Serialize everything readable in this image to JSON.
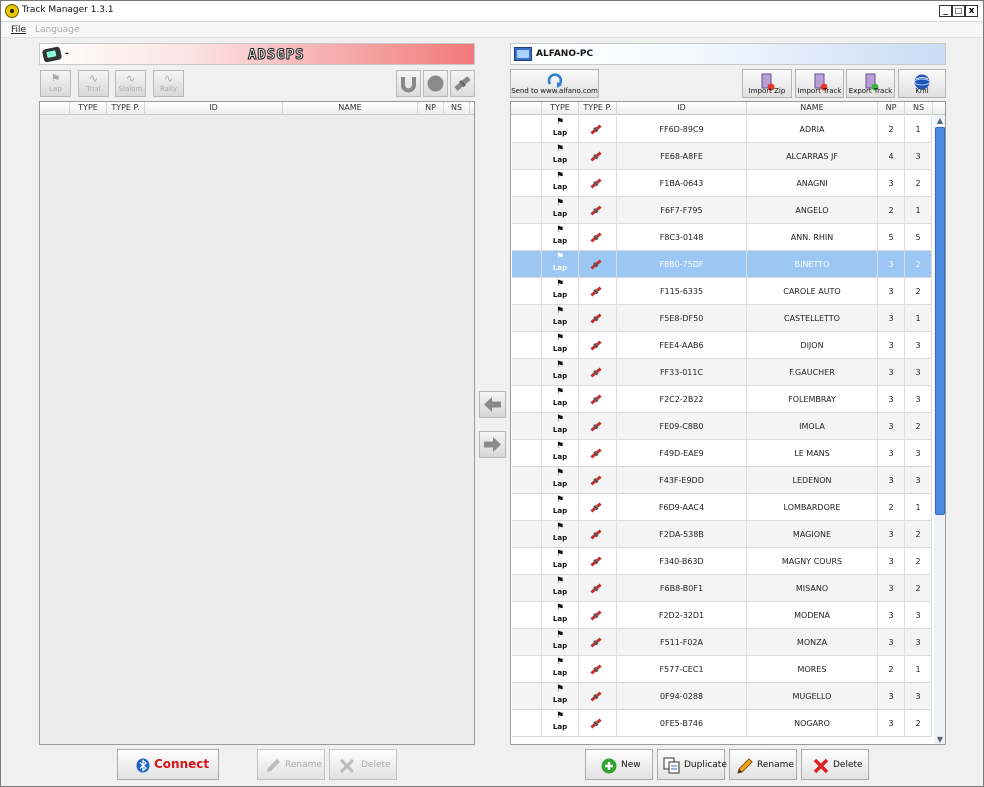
{
  "window": {
    "title": "Track Manager 1.3.1",
    "min": "_",
    "max": "□",
    "close": "x"
  },
  "menu": {
    "file": "File",
    "language": "Language"
  },
  "left_panel": {
    "device_label": "-",
    "logo": "ADSGPS",
    "toolbar": {
      "lap": "Lap",
      "trial": "Trial",
      "slalom": "Slalom",
      "rally": "Rally"
    },
    "columns": {
      "type": "TYPE",
      "type_p": "TYPE P.",
      "id": "ID",
      "name": "NAME",
      "np": "NP",
      "ns": "NS"
    },
    "buttons": {
      "connect": "Connect",
      "rename": "Rename",
      "delete": "Delete"
    }
  },
  "right_panel": {
    "pc_label": "ALFANO-PC",
    "toolbar": {
      "send": "Send to www.alfano.com",
      "import_zip": "Import Zip",
      "import_track": "Import Track",
      "export_track": "Export Track",
      "kml": "Kml"
    },
    "columns": {
      "type": "TYPE",
      "type_p": "TYPE P.",
      "id": "ID",
      "name": "NAME",
      "np": "NP",
      "ns": "NS"
    },
    "buttons": {
      "new": "New",
      "duplicate": "Duplicate",
      "rename": "Rename",
      "delete": "Delete"
    },
    "selected_row_index": 5,
    "tracks": [
      {
        "type": "Lap",
        "id": "FF6D-89C9",
        "name": "ADRIA",
        "np": "2",
        "ns": "1"
      },
      {
        "type": "Lap",
        "id": "FE68-A8FE",
        "name": "ALCARRAS JF",
        "np": "4",
        "ns": "3"
      },
      {
        "type": "Lap",
        "id": "F1BA-0643",
        "name": "ANAGNI",
        "np": "3",
        "ns": "2"
      },
      {
        "type": "Lap",
        "id": "F6F7-F795",
        "name": "ANGELO",
        "np": "2",
        "ns": "1"
      },
      {
        "type": "Lap",
        "id": "F8C3-0148",
        "name": "ANN. RHIN",
        "np": "5",
        "ns": "5"
      },
      {
        "type": "Lap",
        "id": "F8B0-75DF",
        "name": "BINETTO",
        "np": "3",
        "ns": "2"
      },
      {
        "type": "Lap",
        "id": "F115-6335",
        "name": "CAROLE AUTO",
        "np": "3",
        "ns": "2"
      },
      {
        "type": "Lap",
        "id": "F5E8-DF50",
        "name": "CASTELLETTO",
        "np": "3",
        "ns": "1"
      },
      {
        "type": "Lap",
        "id": "FEE4-AAB6",
        "name": "DIJON",
        "np": "3",
        "ns": "3"
      },
      {
        "type": "Lap",
        "id": "FF33-011C",
        "name": "F.GAUCHER",
        "np": "3",
        "ns": "3"
      },
      {
        "type": "Lap",
        "id": "F2C2-2B22",
        "name": "FOLEMBRAY",
        "np": "3",
        "ns": "3"
      },
      {
        "type": "Lap",
        "id": "FE09-C8B0",
        "name": "IMOLA",
        "np": "3",
        "ns": "2"
      },
      {
        "type": "Lap",
        "id": "F49D-EAE9",
        "name": "LE MANS",
        "np": "3",
        "ns": "3"
      },
      {
        "type": "Lap",
        "id": "F43F-E9DD",
        "name": "LEDENON",
        "np": "3",
        "ns": "3"
      },
      {
        "type": "Lap",
        "id": "F6D9-AAC4",
        "name": "LOMBARDORE",
        "np": "2",
        "ns": "1"
      },
      {
        "type": "Lap",
        "id": "F2DA-538B",
        "name": "MAGIONE",
        "np": "3",
        "ns": "2"
      },
      {
        "type": "Lap",
        "id": "F340-B63D",
        "name": "MAGNY COURS",
        "np": "3",
        "ns": "2"
      },
      {
        "type": "Lap",
        "id": "F6B8-B0F1",
        "name": "MISANO",
        "np": "3",
        "ns": "2"
      },
      {
        "type": "Lap",
        "id": "F2D2-32D1",
        "name": "MODENA",
        "np": "3",
        "ns": "3"
      },
      {
        "type": "Lap",
        "id": "F511-F02A",
        "name": "MONZA",
        "np": "3",
        "ns": "3"
      },
      {
        "type": "Lap",
        "id": "F577-CEC1",
        "name": "MORES",
        "np": "2",
        "ns": "1"
      },
      {
        "type": "Lap",
        "id": "0F94-0288",
        "name": "MUGELLO",
        "np": "3",
        "ns": "3"
      },
      {
        "type": "Lap",
        "id": "0FE5-B746",
        "name": "NOGARO",
        "np": "3",
        "ns": "2"
      }
    ]
  },
  "colors": {
    "selection": "#9cc6f3",
    "scroll_thumb": "#4a8ae0",
    "connect_text": "#d6141b",
    "logo_band": "#f1797a"
  }
}
